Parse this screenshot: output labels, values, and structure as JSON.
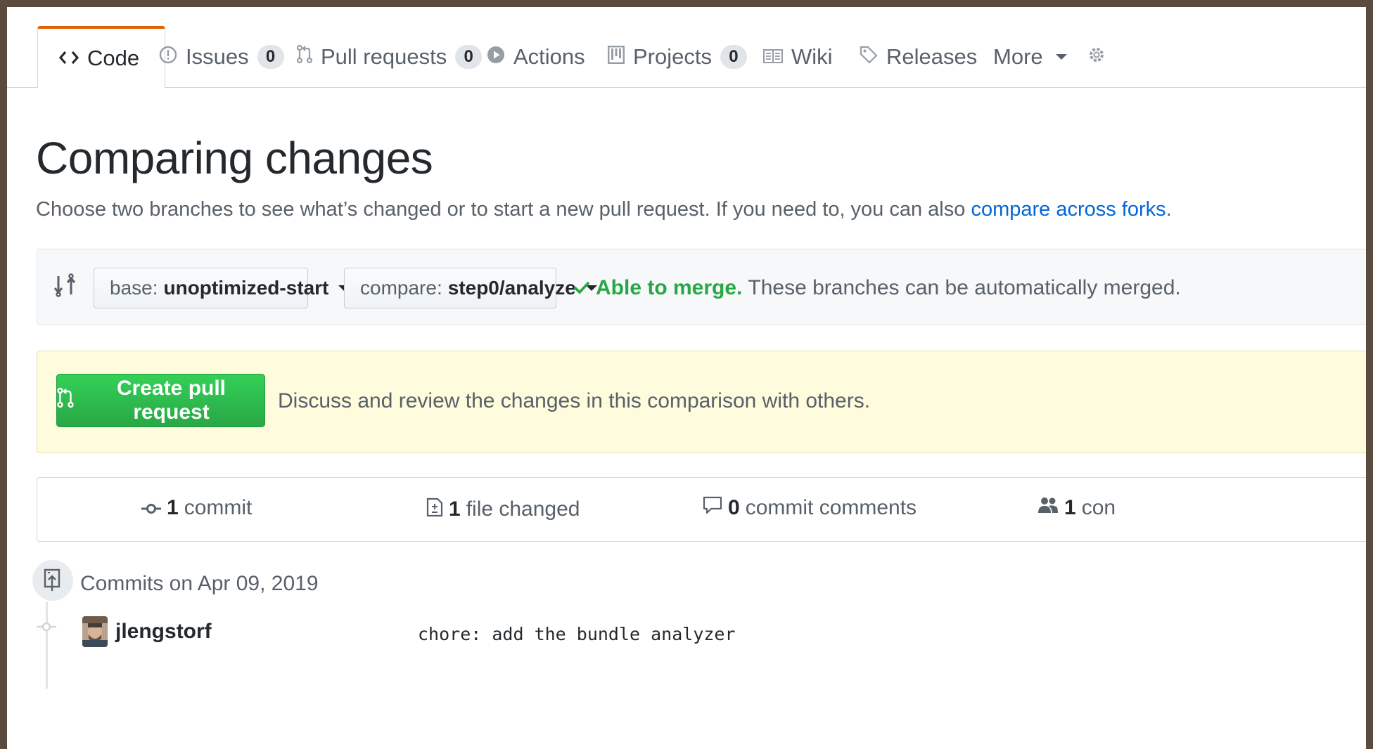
{
  "tabs": {
    "code": {
      "label": "Code"
    },
    "issues": {
      "label": "Issues",
      "count": "0"
    },
    "pulls": {
      "label": "Pull requests",
      "count": "0"
    },
    "actions": {
      "label": "Actions"
    },
    "projects": {
      "label": "Projects",
      "count": "0"
    },
    "wiki": {
      "label": "Wiki"
    },
    "releases": {
      "label": "Releases"
    },
    "more": {
      "label": "More"
    }
  },
  "header": {
    "title": "Comparing changes",
    "subtitle_prefix": "Choose two branches to see what’s changed or to start a new pull request. If you need to, you can also",
    "subtitle_link": "compare across forks",
    "subtitle_suffix": "."
  },
  "range": {
    "base_prefix": "base:",
    "base_branch": "unoptimized-start",
    "compare_prefix": "compare:",
    "compare_branch": "step0/analyze",
    "merge_ok": "Able to merge.",
    "merge_text": "These branches can be automatically merged."
  },
  "banner": {
    "button_label": "Create pull request",
    "text": "Discuss and review the changes in this comparison with others."
  },
  "summary": {
    "commits_count": "1",
    "commits_label": "commit",
    "files_count": "1",
    "files_label": "file changed",
    "comments_count": "0",
    "comments_label": "commit comments",
    "contributors_count": "1",
    "contributors_label": "con"
  },
  "commits": {
    "date_heading": "Commits on Apr 09, 2019",
    "items": [
      {
        "author": "jlengstorf",
        "message": "chore: add the bundle analyzer"
      }
    ]
  },
  "colors": {
    "accent_orange": "#e36209",
    "link_blue": "#0366d6",
    "success_green": "#28a745",
    "banner_yellow": "#fffbdd"
  }
}
